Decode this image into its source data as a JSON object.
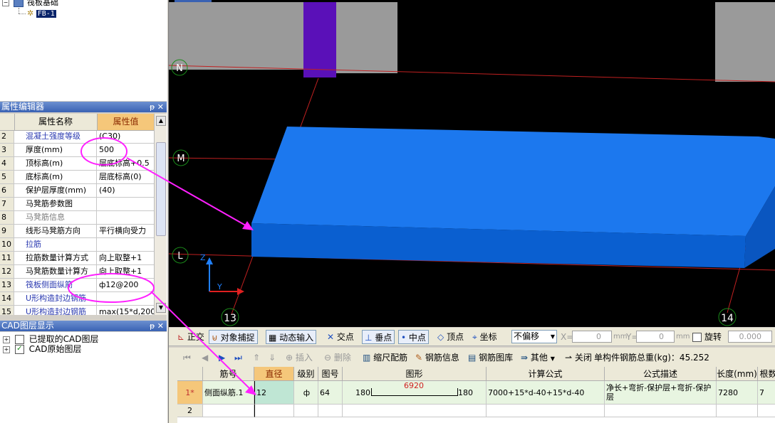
{
  "tree": {
    "root_label": "筏板基础",
    "child_label": "FB-1"
  },
  "property_editor": {
    "title": "属性编辑器",
    "header_buttons": "ᵽ ✕",
    "col_name": "属性名称",
    "col_value": "属性值",
    "rows": [
      {
        "num": "2",
        "name": "混凝土强度等级",
        "value": "(C30)",
        "style": "blue"
      },
      {
        "num": "3",
        "name": "厚度(mm)",
        "value": "500",
        "style": ""
      },
      {
        "num": "4",
        "name": "顶标高(m)",
        "value": "层底标高+0.5",
        "style": ""
      },
      {
        "num": "5",
        "name": "底标高(m)",
        "value": "层底标高(0)",
        "style": ""
      },
      {
        "num": "6",
        "name": "保护层厚度(mm)",
        "value": "(40)",
        "style": ""
      },
      {
        "num": "7",
        "name": "马凳筋参数图",
        "value": "",
        "style": ""
      },
      {
        "num": "8",
        "name": "马凳筋信息",
        "value": "",
        "style": "grey"
      },
      {
        "num": "9",
        "name": "线形马凳筋方向",
        "value": "平行横向受力",
        "style": ""
      },
      {
        "num": "10",
        "name": "拉筋",
        "value": "",
        "style": "blue"
      },
      {
        "num": "11",
        "name": "拉筋数量计算方式",
        "value": "向上取整+1",
        "style": ""
      },
      {
        "num": "12",
        "name": "马凳筋数量计算方",
        "value": "向上取整+1",
        "style": ""
      },
      {
        "num": "13",
        "name": "筏板侧面纵筋",
        "value": "ф12@200",
        "style": "blue"
      },
      {
        "num": "14",
        "name": "U形构造封边钢筋",
        "value": "",
        "style": "blue"
      },
      {
        "num": "15",
        "name": "U形构造封边钢筋",
        "value": "max(15*d,200",
        "style": "blue"
      }
    ]
  },
  "cad_panel": {
    "title": "CAD图层显示",
    "header_buttons": "ᵽ ✕",
    "items": [
      {
        "label": "已提取的CAD图层",
        "checked": false
      },
      {
        "label": "CAD原始图层",
        "checked": true
      }
    ]
  },
  "viewport": {
    "axis_labels": [
      "N",
      "M",
      "L",
      "13",
      "14"
    ],
    "coord_labels": {
      "z": "Z",
      "y": "Y"
    }
  },
  "snap_toolbar": {
    "orthogonal": "正交",
    "object_snap": "对象捕捉",
    "dynamic_input": "动态输入",
    "intersection": "交点",
    "perpendicular": "垂点",
    "midpoint": "中点",
    "vertex": "顶点",
    "coordinate": "坐标",
    "offset_select": "不偏移",
    "x_label": "X=",
    "x_value": "0",
    "mm1": "mm",
    "y_label": "Y=",
    "y_value": "0",
    "mm2": "mm",
    "rotate": "旋转",
    "rotate_value": "0.000"
  },
  "rebar_toolbar": {
    "insert": "插入",
    "delete": "删除",
    "scale_config": "缩尺配筋",
    "rebar_info": "钢筋信息",
    "rebar_library": "钢筋图库",
    "other": "其他",
    "close": "关闭",
    "total_weight": "单构件钢筋总重(kg)：45.252"
  },
  "rebar_grid": {
    "headers": [
      "筋号",
      "直径(mm)",
      "级别",
      "图号",
      "图形",
      "计算公式",
      "公式描述",
      "长度(mm)",
      "根数"
    ],
    "rows": [
      {
        "row_label": "1*",
        "name": "侧面纵筋.1",
        "diameter": "12",
        "grade": "ф",
        "figure_no": "64",
        "shape_left": "180",
        "shape_mid": "6920",
        "shape_right": "180",
        "formula": "7000+15*d-40+15*d-40",
        "description": "净长+弯折-保护层+弯折-保护层",
        "length": "7280",
        "count": "7"
      },
      {
        "row_label": "2"
      }
    ]
  }
}
